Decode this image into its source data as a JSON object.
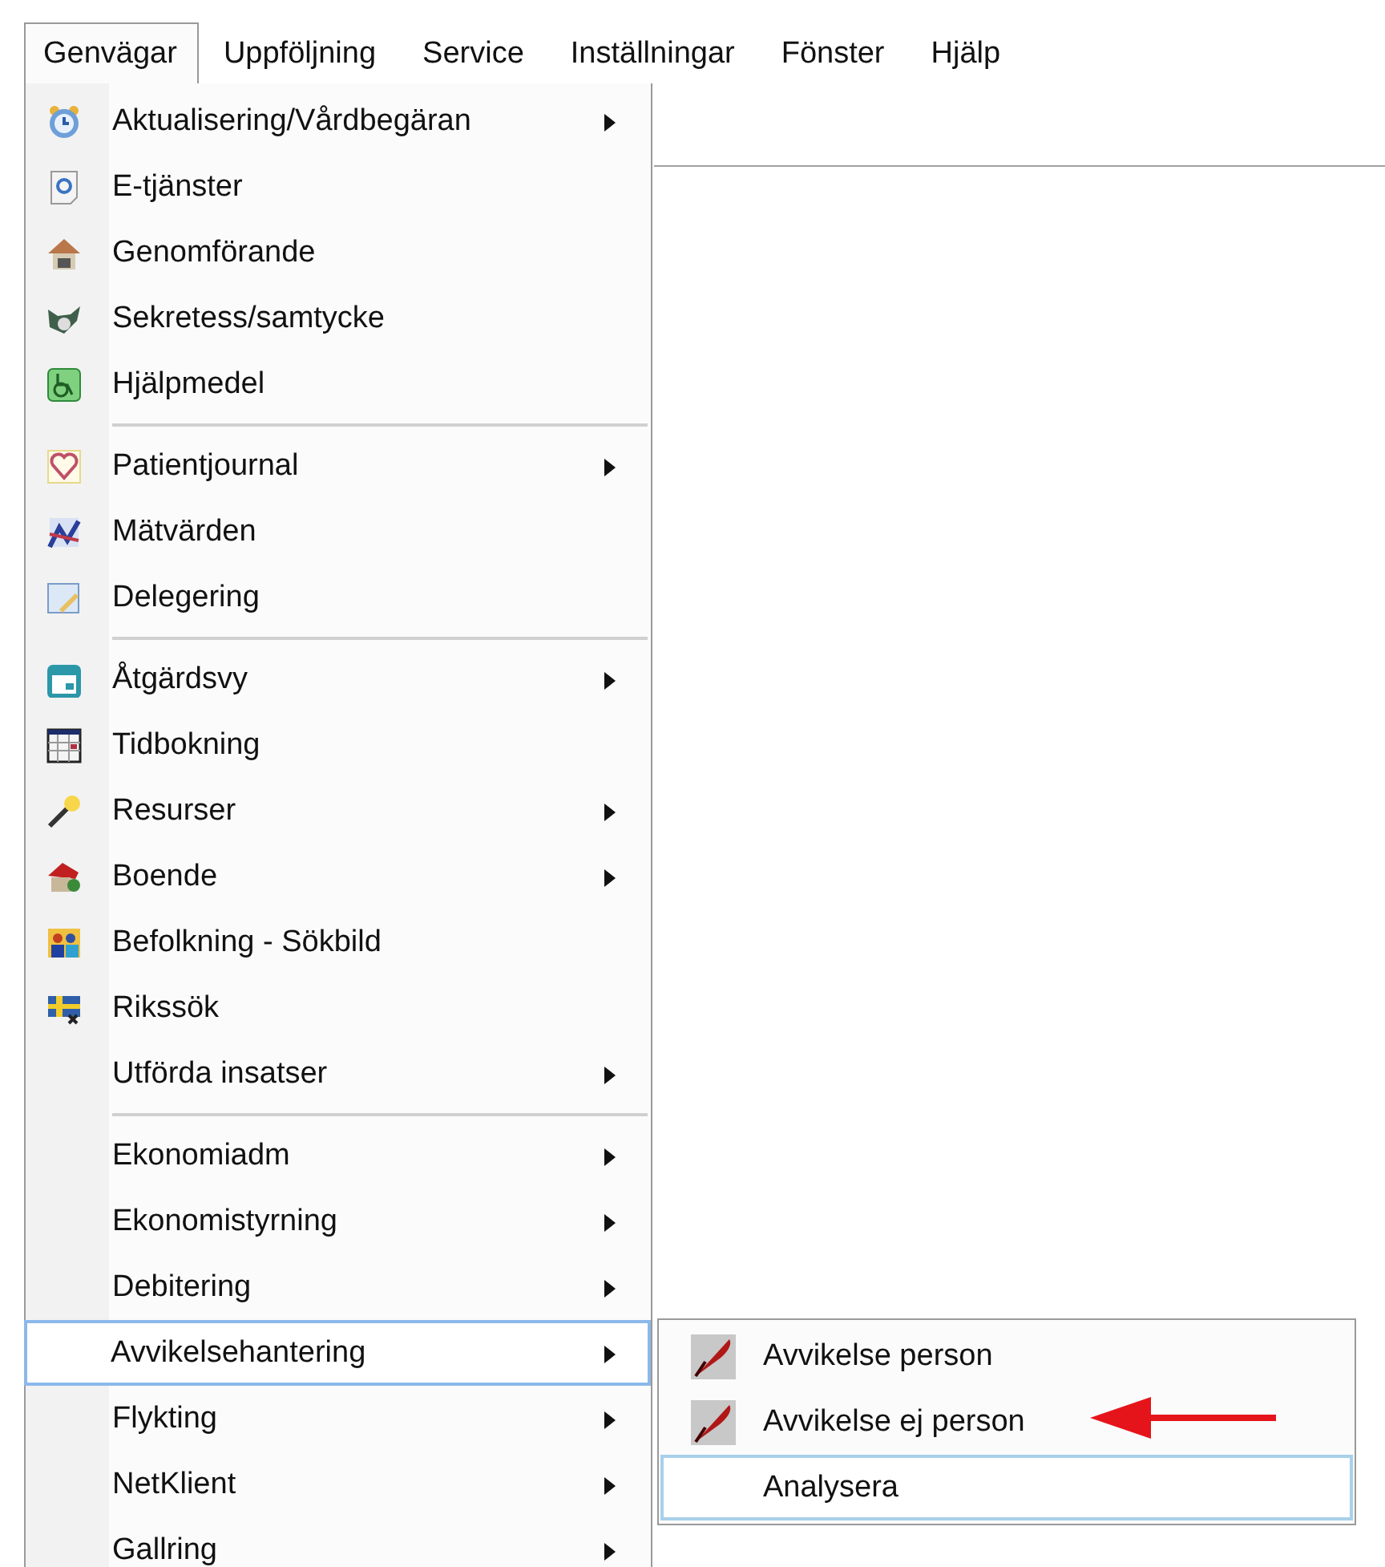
{
  "menubar": [
    {
      "label": "Genvägar",
      "selected": true
    },
    {
      "label": "Uppföljning",
      "selected": false
    },
    {
      "label": "Service",
      "selected": false
    },
    {
      "label": "Inställningar",
      "selected": false
    },
    {
      "label": "Fönster",
      "selected": false
    },
    {
      "label": "Hjälp",
      "selected": false
    }
  ],
  "menu": {
    "groups": [
      [
        {
          "label": "Aktualisering/Vårdbegäran",
          "submenu": true,
          "selected": false
        },
        {
          "label": "E-tjänster",
          "submenu": false,
          "selected": false
        },
        {
          "label": "Genomförande",
          "submenu": false,
          "selected": false
        },
        {
          "label": "Sekretess/samtycke",
          "submenu": false,
          "selected": false
        },
        {
          "label": "Hjälpmedel",
          "submenu": false,
          "selected": false
        }
      ],
      [
        {
          "label": "Patientjournal",
          "submenu": true,
          "selected": false
        },
        {
          "label": "Mätvärden",
          "submenu": false,
          "selected": false
        },
        {
          "label": "Delegering",
          "submenu": false,
          "selected": false
        }
      ],
      [
        {
          "label": "Åtgärdsvy",
          "submenu": true,
          "selected": false
        },
        {
          "label": "Tidbokning",
          "submenu": false,
          "selected": false
        },
        {
          "label": "Resurser",
          "submenu": true,
          "selected": false
        },
        {
          "label": "Boende",
          "submenu": true,
          "selected": false
        },
        {
          "label": "Befolkning - Sökbild",
          "submenu": false,
          "selected": false
        },
        {
          "label": "Rikssök",
          "submenu": false,
          "selected": false
        },
        {
          "label": "Utförda insatser",
          "submenu": true,
          "selected": false
        }
      ],
      [
        {
          "label": "Ekonomiadm",
          "submenu": true,
          "selected": false
        },
        {
          "label": "Ekonomistyrning",
          "submenu": true,
          "selected": false
        },
        {
          "label": "Debitering",
          "submenu": true,
          "selected": false
        },
        {
          "label": "Avvikelsehantering",
          "submenu": true,
          "selected": true
        },
        {
          "label": "Flykting",
          "submenu": true,
          "selected": false
        },
        {
          "label": "NetKlient",
          "submenu": true,
          "selected": false
        },
        {
          "label": "Gallring",
          "submenu": true,
          "selected": false
        }
      ]
    ]
  },
  "submenu": {
    "items": [
      {
        "label": "Avvikelse person",
        "selected": false
      },
      {
        "label": "Avvikelse ej person",
        "selected": false
      },
      {
        "label": "Analysera",
        "selected": true
      }
    ]
  }
}
